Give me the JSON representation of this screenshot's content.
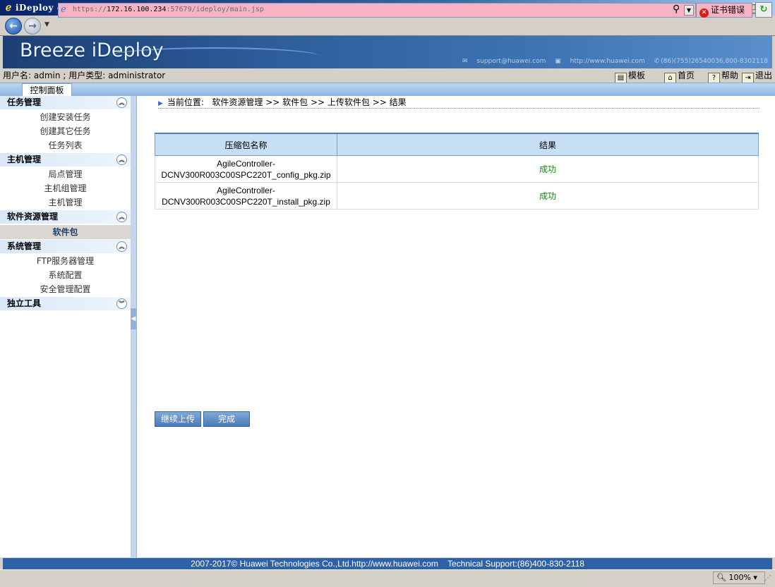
{
  "window": {
    "title": "iDeploy - Internet Explorer"
  },
  "browser": {
    "url_prefix": "https://",
    "url_host": "172.16.100.234",
    "url_rest": ":57679/ideploy/main.jsp",
    "cert_error": "证书错误",
    "zoom": "100%"
  },
  "banner": {
    "logo": "Breeze iDeploy",
    "support_email": "support@huawei.com",
    "website": "http://www.huawei.com",
    "phone": "(86)(755)26540036,800-8302118"
  },
  "userbar": {
    "user_label": "用户名:",
    "user_name": "admin",
    "sep": ";",
    "type_label": "用户类型:",
    "user_type": "administrator",
    "links": {
      "template": "模板",
      "home": "首页",
      "help": "帮助",
      "logout": "退出"
    }
  },
  "tabs": {
    "control_panel": "控制面板"
  },
  "sidebar": {
    "sections": [
      {
        "title": "任务管理",
        "items": [
          "创建安装任务",
          "创建其它任务",
          "任务列表"
        ]
      },
      {
        "title": "主机管理",
        "items": [
          "局点管理",
          "主机组管理",
          "主机管理"
        ]
      },
      {
        "title": "软件资源管理",
        "items": [
          "软件包"
        ]
      },
      {
        "title": "系统管理",
        "items": [
          "FTP服务器管理",
          "系统配置",
          "安全管理配置"
        ]
      },
      {
        "title": "独立工具",
        "items": []
      }
    ]
  },
  "breadcrumb": {
    "label": "当前位置:",
    "path": "软件资源管理 >> 软件包 >> 上传软件包 >> 结果"
  },
  "results_table": {
    "headers": [
      "压缩包名称",
      "结果"
    ],
    "rows": [
      {
        "name_line1": "AgileController-",
        "name_line2": "DCNV300R003C00SPC220T_config_pkg.zip",
        "result": "成功"
      },
      {
        "name_line1": "AgileController-",
        "name_line2": "DCNV300R003C00SPC220T_install_pkg.zip",
        "result": "成功"
      }
    ]
  },
  "buttons": {
    "continue_upload": "继续上传",
    "done": "完成"
  },
  "footer": {
    "text": "2007-2017© Huawei Technologies Co.,Ltd.http://www.huawei.com    Technical Support:(86)400-830-2118"
  },
  "colors": {
    "banner": "#2d5d9b",
    "success": "#0a8a0a",
    "footer": "#2f61a8",
    "address_bar_error": "#f7b2c3"
  }
}
